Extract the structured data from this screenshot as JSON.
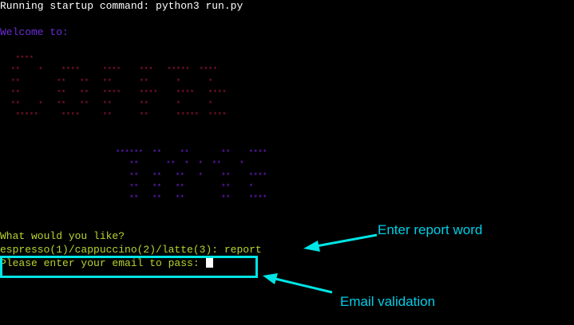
{
  "colors": {
    "background": "#000000",
    "startup_text": "#ffffff",
    "welcome_text": "#6b2cd6",
    "coffee_art": "#a8173c",
    "machine_art": "#7a22e6",
    "prompt_text": "#b8d432",
    "annotation": "#00e5e5",
    "annotation_text": "#00cfe8"
  },
  "terminal": {
    "startup": "Running startup command: python3 run.py",
    "welcome": "Welcome to:",
    "coffee_art": "  ****\n **    *    ****     ****    ***   *****  ****\n **        **   **   **      **      *      *\n **        **   **   ****    ****    ****   ****\n **    *   **   **   **      **      *      *\n  *****     ****     **      **      *****  ****",
    "machine_art": "******  **    **       **    ****\n   **      **  *  *  **    *\n   **   **   **   *    **    ****\n   **   **   **        **    *\n   **   **   **        **    ****",
    "question": "What would you like?",
    "menu_prompt": "espresso(1)/cappuccino(2)/latte(3): ",
    "menu_input": "report",
    "email_prompt": "Please enter your email to pass: "
  },
  "annotations": {
    "report_label": "Enter report word",
    "email_label": "Email validation"
  }
}
